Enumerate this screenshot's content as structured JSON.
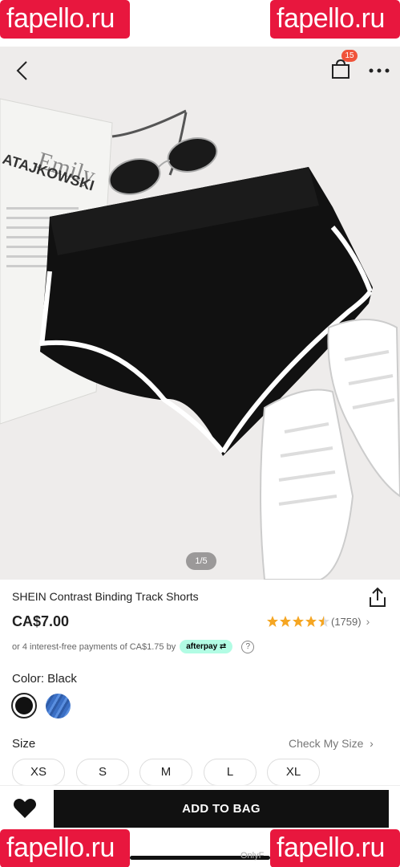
{
  "watermarks": {
    "top_left": "fapello.ru",
    "top_right": "fapello.ru",
    "bottom_left": "fapello.ru",
    "bottom_right": "fapello.ru"
  },
  "statusbar": {
    "carrier": "⸜⸝⸜⸝"
  },
  "topbar": {
    "bag_count": "15"
  },
  "gallery": {
    "pager": "1/5",
    "magazine_text_1": "Emily",
    "magazine_text_2": "ATAJKOWSKI"
  },
  "product": {
    "title": "SHEIN Contrast Binding Track Shorts",
    "price": "CA$7.00",
    "rating_value": 4.5,
    "rating_count": "(1759)",
    "installment_text": "or 4 interest-free payments of CA$1.75 by",
    "afterpay_label": "afterpay",
    "help_icon": "?"
  },
  "color": {
    "label": "Color: Black",
    "options": [
      "black",
      "blue"
    ],
    "colors": {
      "black": "#111111",
      "blue": "#3b6fc4"
    }
  },
  "size": {
    "label": "Size",
    "check_label": "Check My Size",
    "options": [
      "XS",
      "S",
      "M",
      "L",
      "XL"
    ]
  },
  "actions": {
    "add_to_bag": "ADD TO BAG"
  },
  "footer": {
    "overlay_text": "OnlyF"
  },
  "theme": {
    "star_color": "#f5a623",
    "afterpay_color": "#b2fce4",
    "badge_color": "#f0533a"
  }
}
